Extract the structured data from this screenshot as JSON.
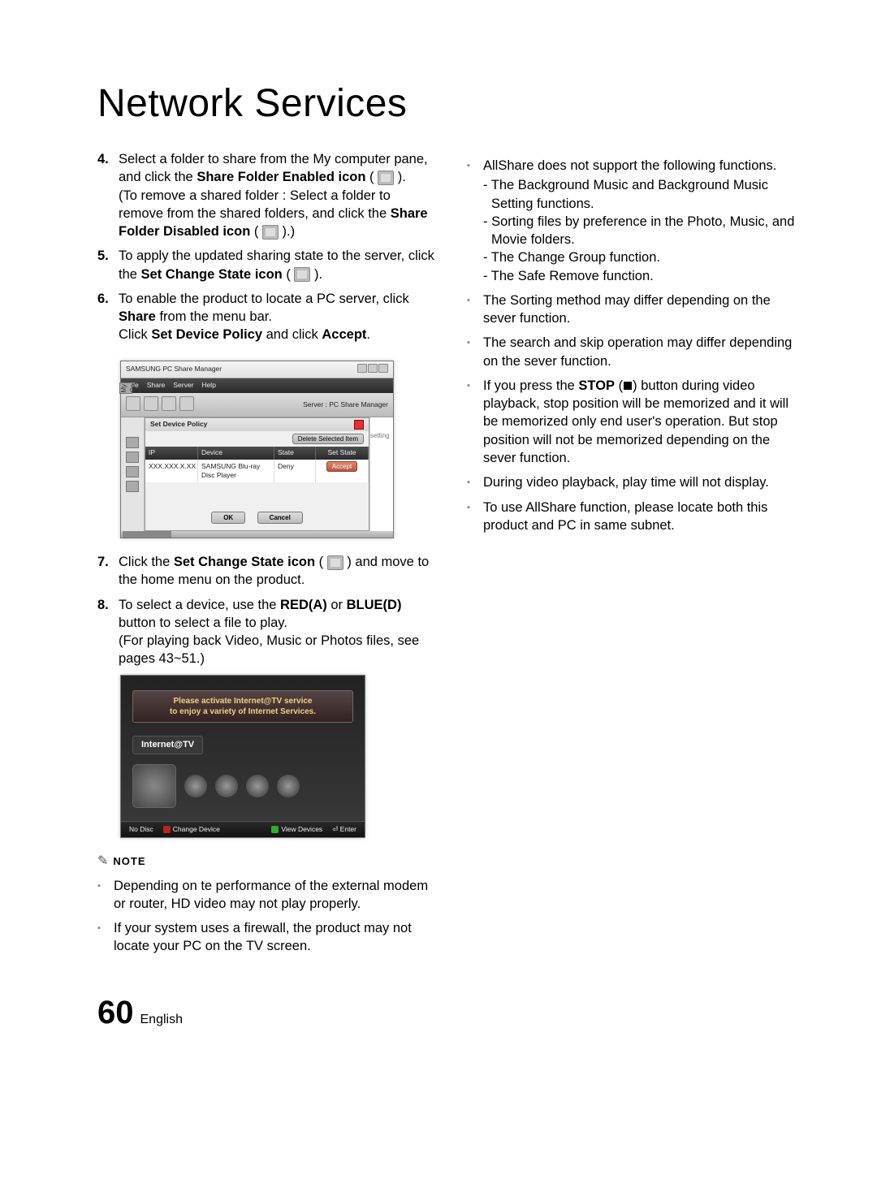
{
  "page": {
    "title": "Network Services",
    "number": "60",
    "language": "English"
  },
  "steps": {
    "s4": {
      "p1a": "Select a folder to share from the My computer pane, and click the ",
      "p1b": "Share Folder Enabled icon",
      "p1c": " ( ",
      "p1d": " ).",
      "p2a": "(To remove a shared folder : Select a folder to remove from the shared folders, and click the ",
      "p2b": "Share Folder Disabled icon",
      "p2c": " ( ",
      "p2d": " ).)"
    },
    "s5": {
      "a": "To apply the updated sharing state to the server, click the ",
      "b": "Set Change State icon",
      "c": " ( ",
      "d": " )."
    },
    "s6": {
      "a": "To enable the product to locate a PC server, click ",
      "b": "Share",
      "c": " from the menu bar.",
      "d": "Click ",
      "e": "Set Device Policy",
      "f": " and click ",
      "g": "Accept",
      "h": "."
    },
    "s7": {
      "a": "Click the ",
      "b": "Set Change State icon",
      "c": " ( ",
      "d": " ) and move to the home menu on the product."
    },
    "s8": {
      "a": "To select a device, use the ",
      "b": "RED(A)",
      "c": " or ",
      "d": "BLUE(D)",
      "e": " button to select a file to play.",
      "f": "(For playing back Video, Music or Photos files, see pages 43~51.)"
    },
    "num4": "4.",
    "num5": "5.",
    "num6": "6.",
    "num7": "7.",
    "num8": "8."
  },
  "note": {
    "label": "NOTE",
    "n1": "Depending on te performance of the external modem or router, HD video may not play properly.",
    "n2": "If your system uses a firewall, the product may not locate your PC on the TV screen.",
    "n3": {
      "head": "AllShare does not support the following functions.",
      "i1": "- The Background Music and Background Music Setting functions.",
      "i2": "- Sorting files by preference in the Photo, Music, and Movie folders.",
      "i3": "- The Change Group function.",
      "i4": "- The Safe Remove function."
    },
    "n4": "The Sorting method may differ depending on the sever function.",
    "n5": "The search and skip operation may differ depending on the sever function.",
    "n6": {
      "a": "If you press the ",
      "b": "STOP",
      "c": " (",
      "d": ") button during video playback, stop position will be memorized and it will be memorized only end user's operation. But stop position will not be memorized depending on the sever function."
    },
    "n7": "During video playback, play time will not display.",
    "n8": "To use AllShare function, please locate both this product and PC in same subnet."
  },
  "pcshare": {
    "appTitle": "SAMSUNG PC Share Manager",
    "menu": {
      "file": "File",
      "share": "Share",
      "server": "Server",
      "help": "Help"
    },
    "serverLabel": "Server : PC Share Manager",
    "dlgTitle": "Set Device Policy",
    "deleteBtn": "Delete Selected Item",
    "cols": {
      "ip": "IP",
      "device": "Device",
      "state": "State",
      "setState": "Set State"
    },
    "row": {
      "ip": "XXX.XXX.X.XX",
      "device": "SAMSUNG Blu-ray Disc Player",
      "state": "Deny",
      "accept": "Accept"
    },
    "ok": "OK",
    "cancel": "Cancel",
    "myComputer": "My Co",
    "rightLabel": "setting"
  },
  "itv": {
    "bannerLine1": "Please activate Internet@TV service",
    "bannerLine2": "to enjoy a variety of Internet Services.",
    "title": "Internet@TV",
    "footer": {
      "nodisc": "No Disc",
      "change": "Change Device",
      "view": "View Devices",
      "enter": "Enter"
    }
  }
}
